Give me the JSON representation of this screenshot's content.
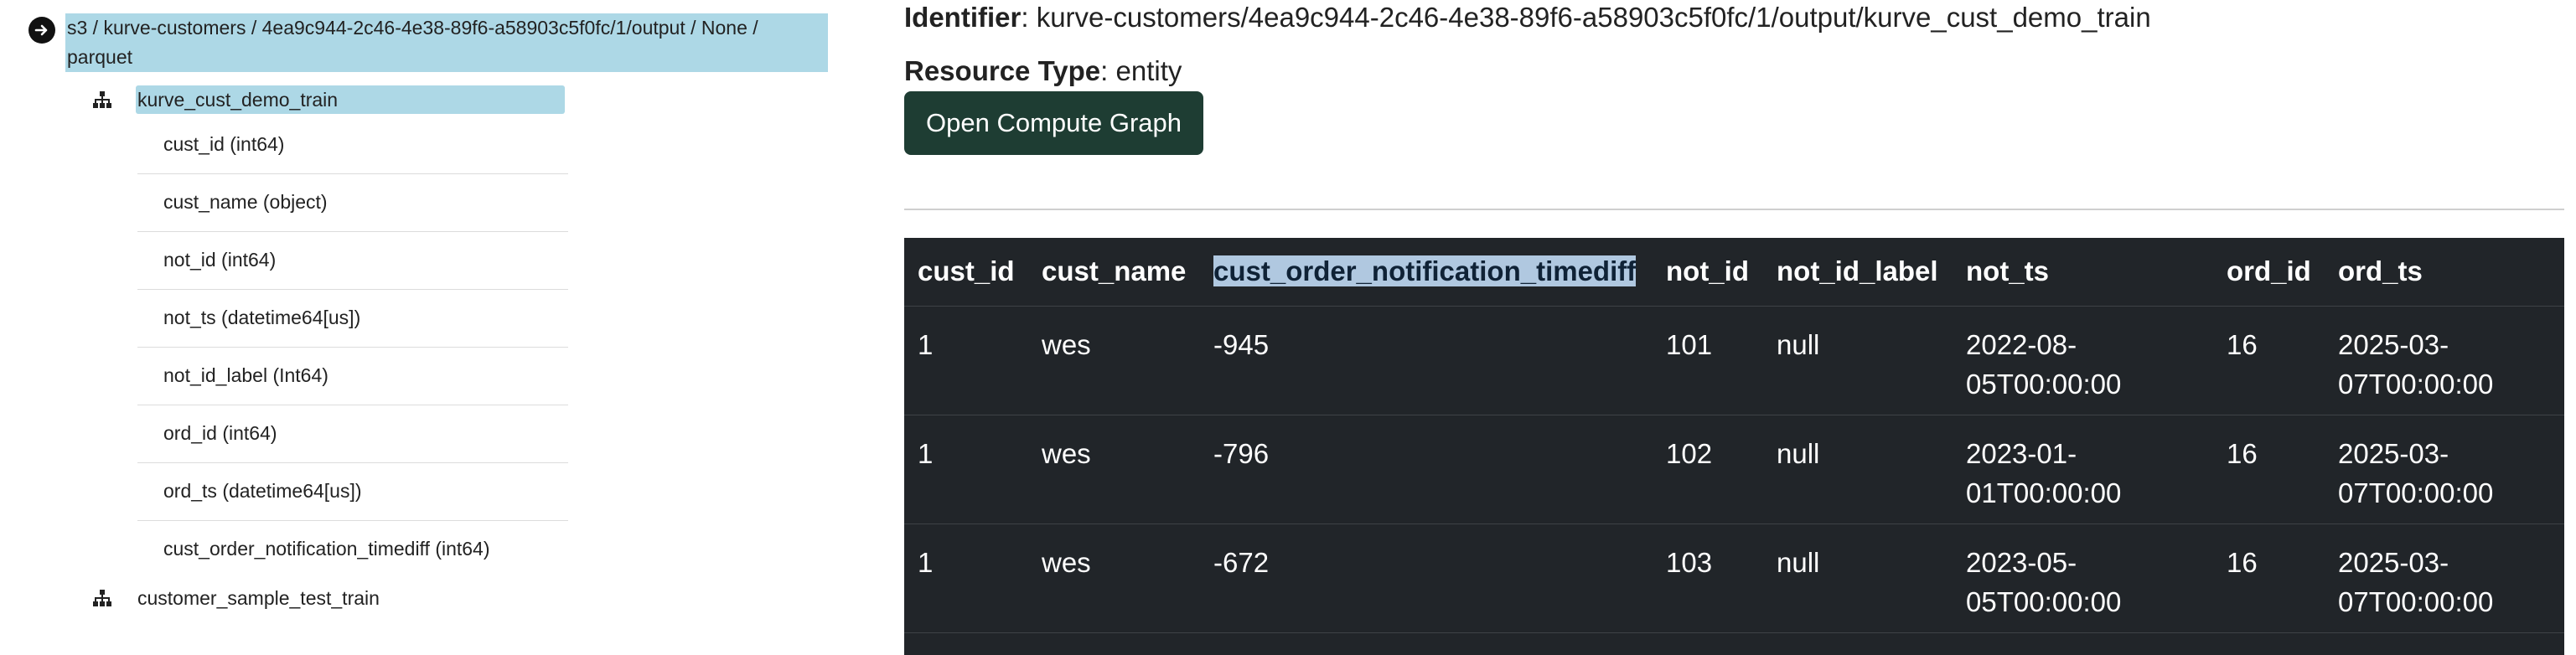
{
  "tree": {
    "source_label": "s3 / kurve-customers / 4ea9c944-2c46-4e38-89f6-a58903c5f0fc/1/output / None / parquet",
    "tables": [
      {
        "name": "kurve_cust_demo_train",
        "selected": true,
        "columns": [
          "cust_id (int64)",
          "cust_name (object)",
          "not_id (int64)",
          "not_ts (datetime64[us])",
          "not_id_label (Int64)",
          "ord_id (int64)",
          "ord_ts (datetime64[us])",
          "cust_order_notification_timediff (int64)"
        ]
      },
      {
        "name": "customer_sample_test_train",
        "selected": false
      }
    ]
  },
  "detail": {
    "identifier_key": "Identifier",
    "identifier_value": "kurve-customers/4ea9c944-2c46-4e38-89f6-a58903c5f0fc/1/output/kurve_cust_demo_train",
    "resource_type_key": "Resource Type",
    "resource_type_value": "entity",
    "open_graph_label": "Open Compute Graph"
  },
  "table": {
    "headers": [
      "cust_id",
      "cust_name",
      "cust_order_notification_timediff",
      "not_id",
      "not_id_label",
      "not_ts",
      "ord_id",
      "ord_ts"
    ],
    "highlighted_header": "cust_order_notification_timediff",
    "rows": [
      [
        "1",
        "wes",
        "-945",
        "101",
        "null",
        "2022-08-05T00:00:00",
        "16",
        "2025-03-07T00:00:00"
      ],
      [
        "1",
        "wes",
        "-796",
        "102",
        "null",
        "2023-01-01T00:00:00",
        "16",
        "2025-03-07T00:00:00"
      ],
      [
        "1",
        "wes",
        "-672",
        "103",
        "null",
        "2023-05-05T00:00:00",
        "16",
        "2025-03-07T00:00:00"
      ]
    ]
  },
  "colors": {
    "selection": "#add8e6",
    "button_bg": "#1e3d33",
    "table_bg": "#212529"
  },
  "icons": {
    "source_toggle": "arrow-right-circle-icon",
    "table_node": "schema-tree-icon"
  }
}
